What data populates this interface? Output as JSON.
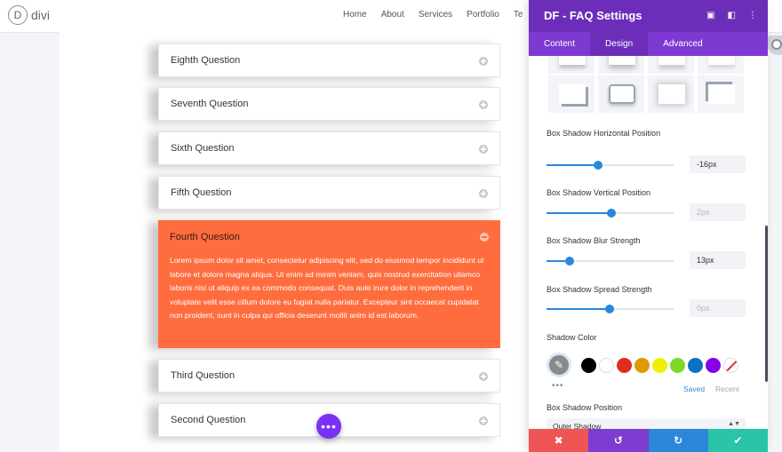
{
  "site": {
    "logo_letter": "D",
    "logo_text": "divi",
    "nav": [
      "Home",
      "About",
      "Services",
      "Portfolio",
      "Te"
    ]
  },
  "faq": {
    "items_above": [
      "Eighth Question",
      "Seventh Question",
      "Sixth Question",
      "Fifth Question"
    ],
    "open_item": {
      "title": "Fourth Question",
      "body": "Lorem ipsum dolor sit amet, consectetur adipiscing elit, sed do eiusmod tempor incididunt ut labore et dolore magna aliqua. Ut enim ad minim veniam, quis nostrud exercitation ullamco laboris nisi ut aliquip ex ea commodo consequat. Duis aute irure dolor in reprehenderit in voluptate velit esse cillum dolore eu fugiat nulla pariatur. Excepteur sint occaecat cupidatat non proident, sunt in culpa qui officia deserunt mollit anim id est laborum."
    },
    "items_below": [
      "Third Question",
      "Second Question"
    ],
    "accent_color": "#ff6d3e"
  },
  "fab": {
    "label": "•••"
  },
  "panel": {
    "title": "DF - FAQ Settings",
    "tabs": [
      "Content",
      "Design",
      "Advanced"
    ],
    "active_tab": "Design",
    "fields": {
      "horizontal": {
        "label": "Box Shadow Horizontal Position",
        "value": "-16px"
      },
      "vertical": {
        "label": "Box Shadow Vertical Position",
        "value": "2px"
      },
      "blur": {
        "label": "Box Shadow Blur Strength",
        "value": "13px"
      },
      "spread": {
        "label": "Box Shadow Spread Strength",
        "value": "0px"
      }
    },
    "shadow_color": {
      "label": "Shadow Color",
      "swatches": [
        "#000000",
        "#ffffff",
        "#e02b20",
        "#e09900",
        "#edf000",
        "#7cda24",
        "#0c71c3",
        "#8300e9"
      ],
      "saved_label": "Saved",
      "recent_label": "Recent",
      "more": "•••"
    },
    "box_shadow_position": {
      "label": "Box Shadow Position",
      "value": "Outer Shadow"
    },
    "footer_colors": [
      "#ef5555",
      "#7e3bd0",
      "#2b87da",
      "#29c4a9"
    ]
  }
}
